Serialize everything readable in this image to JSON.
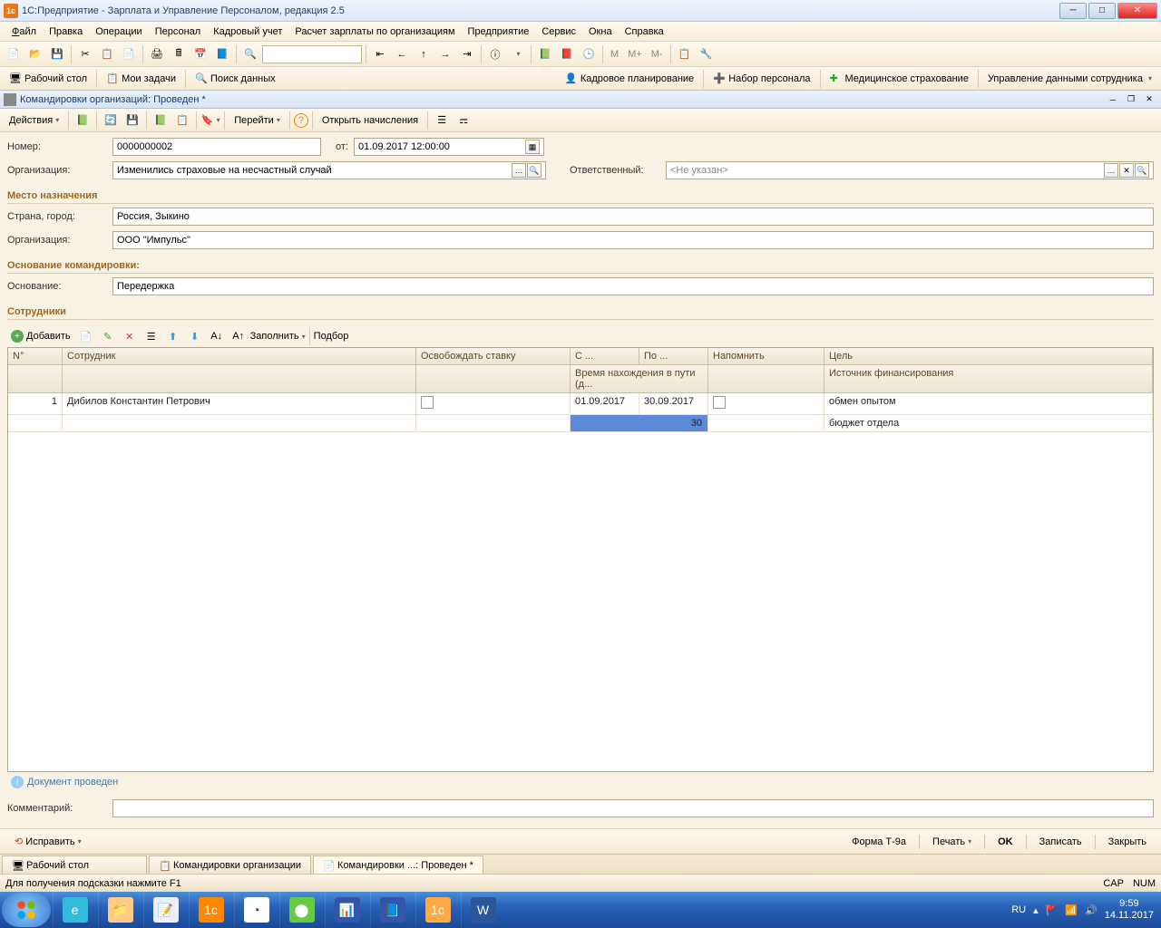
{
  "window": {
    "title": "1С:Предприятие - Зарплата и Управление Персоналом, редакция 2.5"
  },
  "menu": {
    "file": "Файл",
    "edit": "Правка",
    "ops": "Операции",
    "personnel": "Персонал",
    "hr": "Кадровый учет",
    "payroll": "Расчет зарплаты по организациям",
    "enterprise": "Предприятие",
    "service": "Сервис",
    "windows": "Окна",
    "help": "Справка"
  },
  "tb2": {
    "desktop": "Рабочий стол",
    "tasks": "Мои задачи",
    "search": "Поиск данных",
    "kp": "Кадровое планирование",
    "np": "Набор персонала",
    "ms": "Медицинское страхование",
    "uds": "Управление данными сотрудника"
  },
  "doc": {
    "title": "Командировки организаций: Проведен *",
    "actions": "Действия",
    "goto": "Перейти",
    "open": "Открыть начисления",
    "num_lbl": "Номер:",
    "num": "0000000002",
    "from_lbl": "от:",
    "from": "01.09.2017 12:00:00",
    "org_lbl": "Организация:",
    "org": "Изменились страховые на несчастный случай",
    "resp_lbl": "Ответственный:",
    "resp": "<Не указан>",
    "sec_dest": "Место назначения",
    "country_lbl": "Страна, город:",
    "country": "Россия, Зыкино",
    "org2_lbl": "Организация:",
    "org2": "ООО \"Импульс\"",
    "sec_basis": "Основание командировки:",
    "basis_lbl": "Основание:",
    "basis": "Передержка",
    "sec_emp": "Сотрудники",
    "add": "Добавить",
    "fill": "Заполнить",
    "select": "Подбор",
    "cols": {
      "n": "N°",
      "emp": "Сотрудник",
      "release": "Освобождать ставку",
      "from": "С ...",
      "to": "По ...",
      "remind": "Напомнить",
      "goal": "Цель",
      "travel": "Время нахождения в пути (д...",
      "src": "Источник финансирования"
    },
    "row": {
      "n": "1",
      "emp": "Дибилов Константин Петрович",
      "from": "01.09.2017",
      "to": "30.09.2017",
      "days": "30",
      "goal": "обмен опытом",
      "src": "бюджет отдела"
    },
    "posted": "Документ проведен",
    "comment_lbl": "Комментарий:",
    "fix": "Исправить",
    "formT": "Форма Т-9а",
    "print": "Печать",
    "ok": "OK",
    "save": "Записать",
    "close": "Закрыть"
  },
  "tabs": {
    "t1": "Рабочий стол",
    "t2": "Командировки организации",
    "t3": "Командировки ...: Проведен *"
  },
  "status": {
    "hint": "Для получения подсказки нажмите F1",
    "cap": "CAP",
    "num": "NUM"
  },
  "tray": {
    "lang": "RU",
    "time": "9:59",
    "date": "14.11.2017"
  }
}
